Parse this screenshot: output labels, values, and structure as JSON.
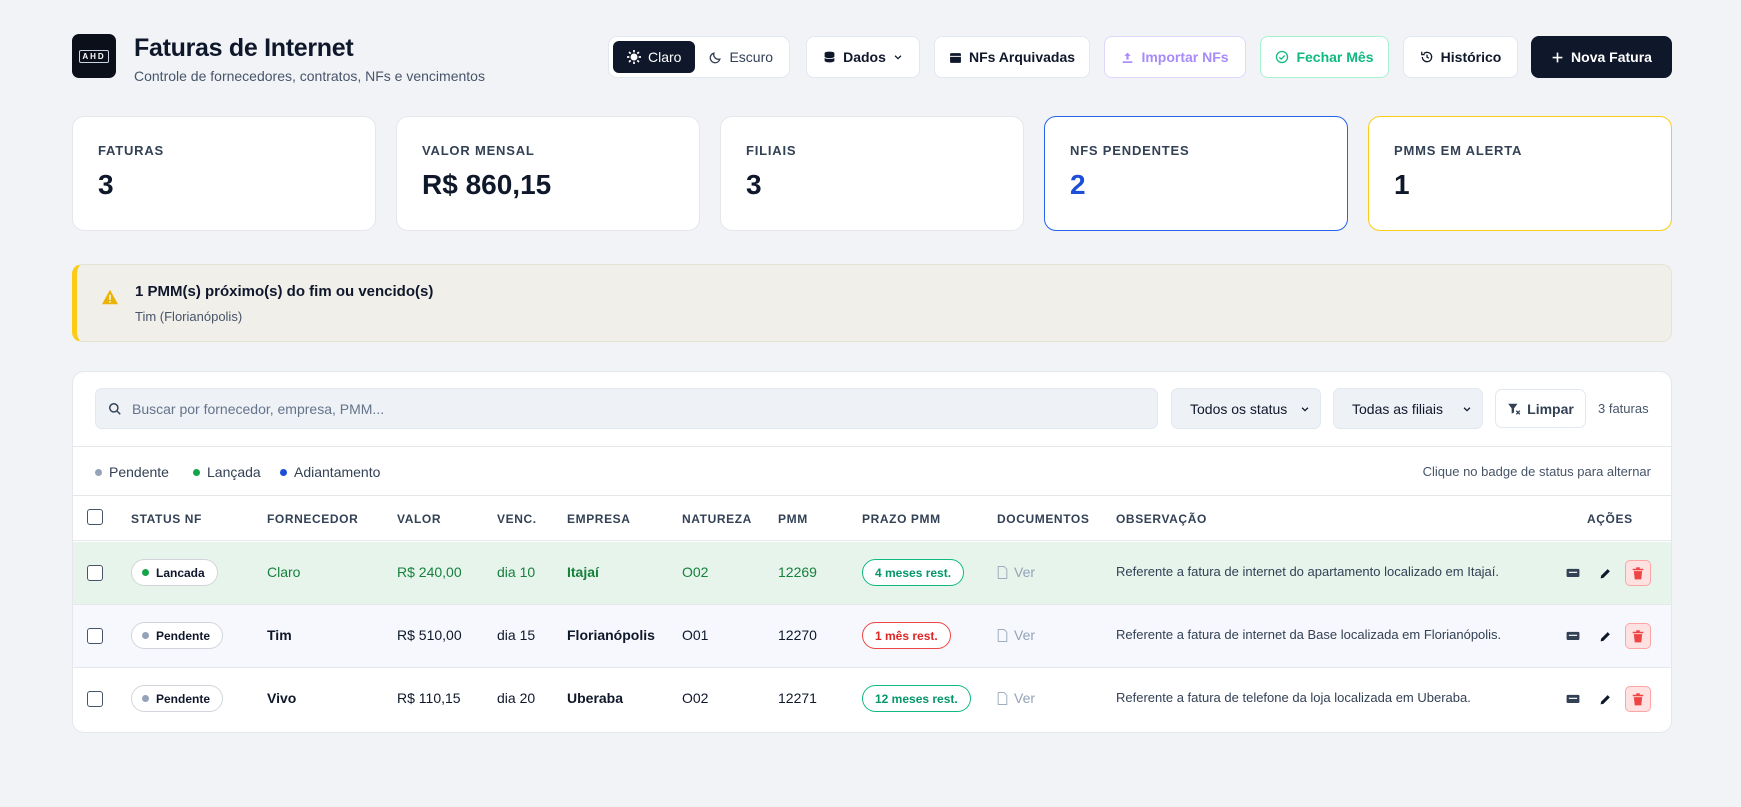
{
  "header": {
    "logo_text": "AHD",
    "title": "Faturas de Internet",
    "subtitle": "Controle de fornecedores, contratos, NFs e vencimentos",
    "theme": {
      "light_label": "Claro",
      "dark_label": "Escuro",
      "active": "light"
    },
    "buttons": {
      "dados": "Dados",
      "arquivadas": "NFs Arquivadas",
      "importar": "Importar NFs",
      "fechar": "Fechar Mês",
      "historico": "Histórico",
      "nova": "Nova Fatura"
    }
  },
  "stats": [
    {
      "label": "FATURAS",
      "value": "3"
    },
    {
      "label": "VALOR MENSAL",
      "value": "R$ 860,15"
    },
    {
      "label": "FILIAIS",
      "value": "3"
    },
    {
      "label": "NFS PENDENTES",
      "value": "2"
    },
    {
      "label": "PMMS EM ALERTA",
      "value": "1"
    }
  ],
  "alert": {
    "title": "1 PMM(s) próximo(s) do fim ou vencido(s)",
    "detail": "Tim (Florianópolis)"
  },
  "filters": {
    "search_placeholder": "Buscar por fornecedor, empresa, PMM...",
    "status_select": "Todos os status",
    "filial_select": "Todas as filiais",
    "clear_label": "Limpar",
    "count": "3 faturas"
  },
  "legend": {
    "items": [
      {
        "label": "Pendente",
        "color": "#94a3b8"
      },
      {
        "label": "Lançada",
        "color": "#16a34a"
      },
      {
        "label": "Adiantamento",
        "color": "#1d4ed8"
      }
    ],
    "hint": "Clique no badge de status para alternar"
  },
  "table": {
    "headers": [
      "STATUS NF",
      "FORNECEDOR",
      "VALOR",
      "VENC.",
      "EMPRESA",
      "NATUREZA",
      "PMM",
      "PRAZO PMM",
      "DOCUMENTOS",
      "OBSERVAÇÃO",
      "AÇÕES"
    ],
    "rows": [
      {
        "status": "Lancada",
        "status_color": "#16a34a",
        "fornecedor": "Claro",
        "valor": "R$ 240,00",
        "venc": "dia 10",
        "empresa": "Itajaí",
        "natureza": "O02",
        "pmm": "12269",
        "prazo": "4 meses rest.",
        "prazo_state": "ok",
        "docs": "Ver",
        "obs": "Referente a fatura de internet do apartamento localizado em Itajaí."
      },
      {
        "status": "Pendente",
        "status_color": "#94a3b8",
        "fornecedor": "Tim",
        "valor": "R$ 510,00",
        "venc": "dia 15",
        "empresa": "Florianópolis",
        "natureza": "O01",
        "pmm": "12270",
        "prazo": "1 mês rest.",
        "prazo_state": "bad",
        "docs": "Ver",
        "obs": "Referente a fatura de internet da Base localizada em Florianópolis."
      },
      {
        "status": "Pendente",
        "status_color": "#94a3b8",
        "fornecedor": "Vivo",
        "valor": "R$ 110,15",
        "venc": "dia 20",
        "empresa": "Uberaba",
        "natureza": "O02",
        "pmm": "12271",
        "prazo": "12 meses rest.",
        "prazo_state": "ok",
        "docs": "Ver",
        "obs": "Referente a fatura de telefone da loja localizada em Uberaba."
      }
    ]
  },
  "icons": {
    "theme_light": "sun-icon",
    "theme_dark": "moon-icon",
    "dados": "database-icon",
    "arquivadas": "calendar-icon",
    "importar": "upload-icon",
    "fechar": "check-circle-icon",
    "historico": "history-icon",
    "nova": "plus-icon",
    "alert": "warning-icon",
    "search": "search-icon",
    "clear": "filter-x-icon",
    "actions": [
      "comment-icon",
      "pencil-icon",
      "trash-icon"
    ]
  }
}
